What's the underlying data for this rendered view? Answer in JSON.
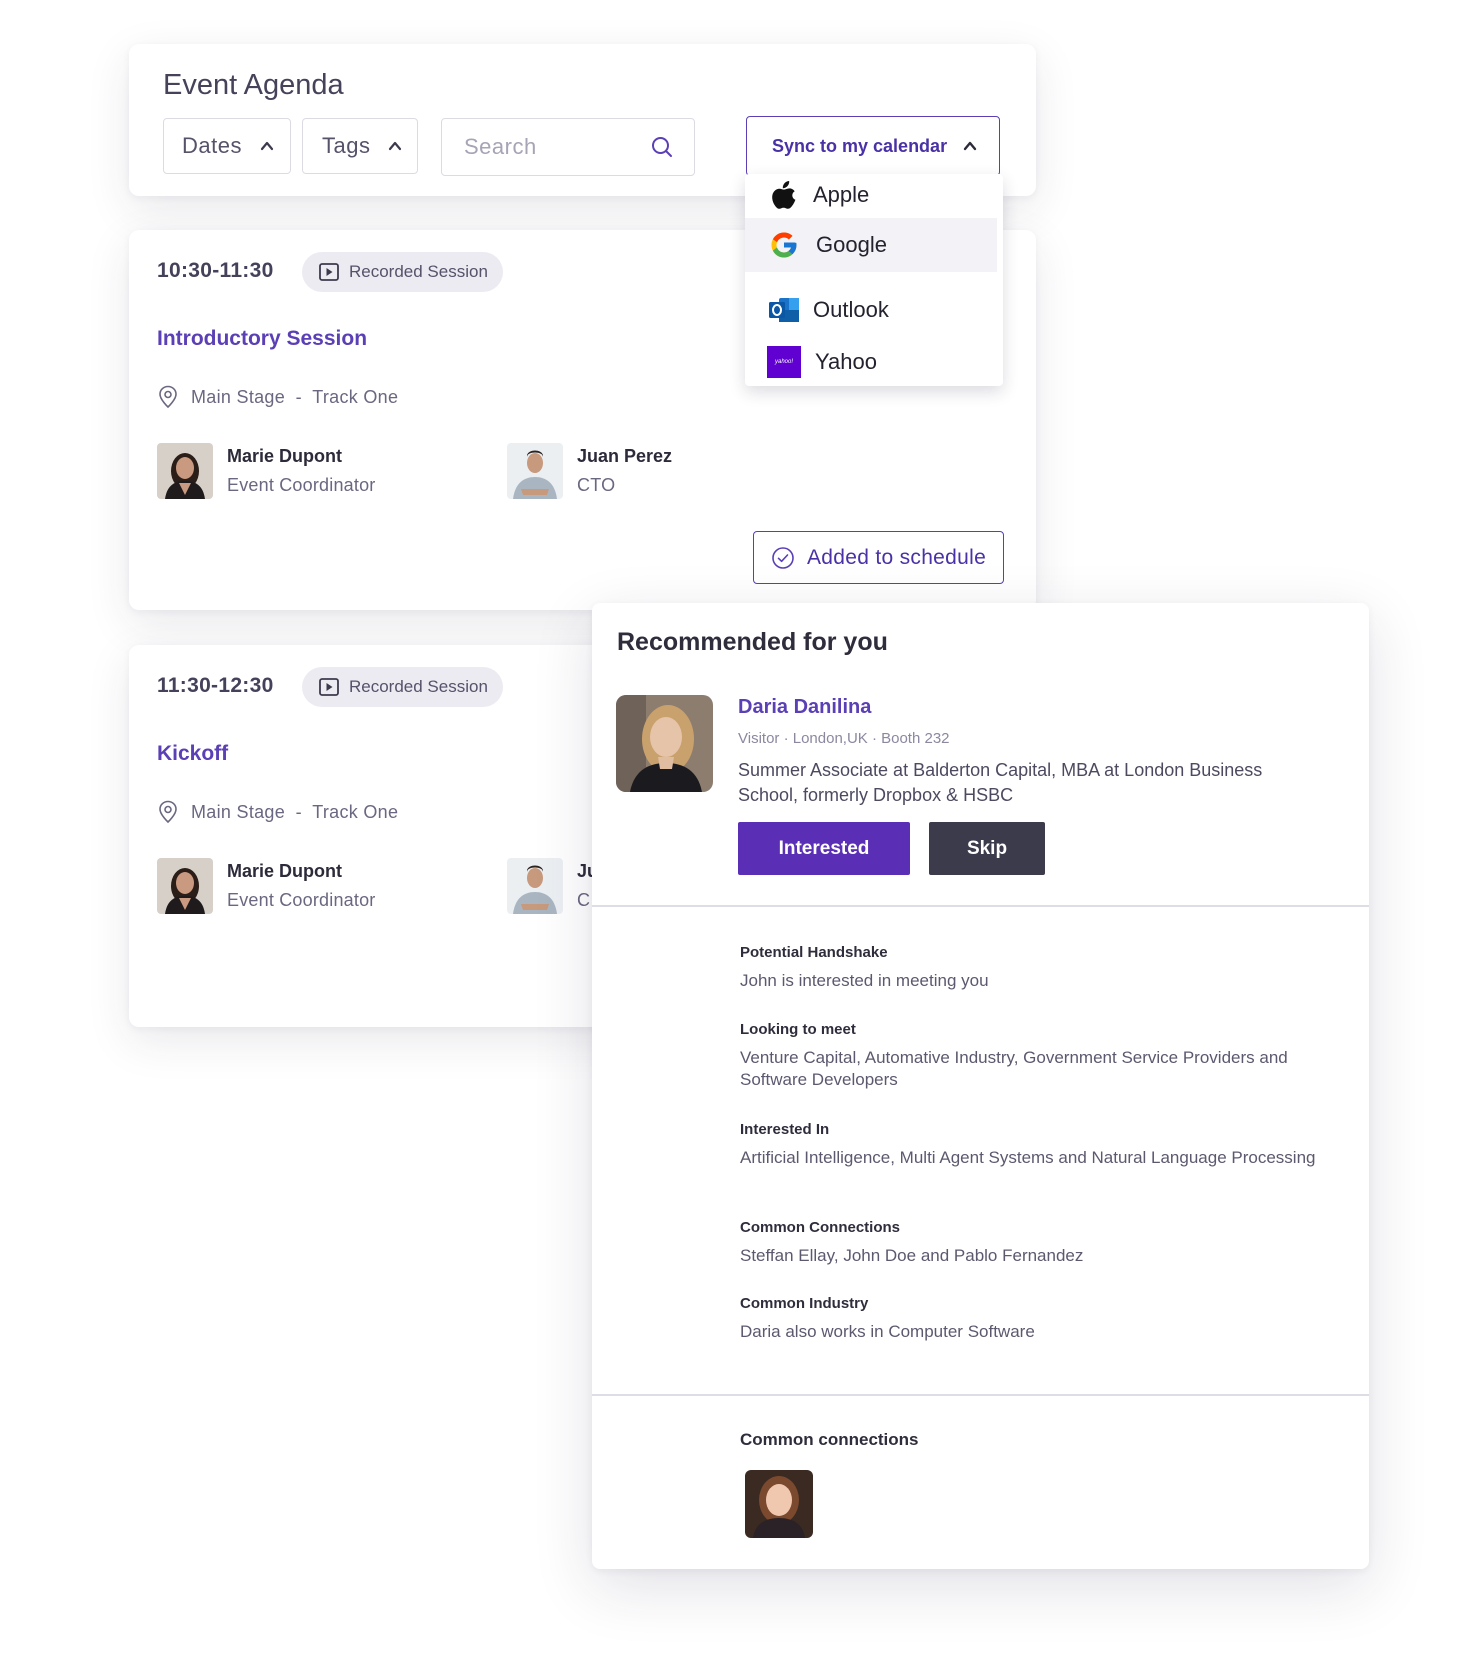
{
  "agenda": {
    "title": "Event Agenda",
    "filters": {
      "dates_label": "Dates",
      "tags_label": "Tags"
    },
    "search": {
      "placeholder": "Search"
    },
    "sync": {
      "label": "Sync to my calendar",
      "options": [
        {
          "label": "Apple",
          "icon": "apple-icon"
        },
        {
          "label": "Google",
          "icon": "google-icon"
        },
        {
          "label": "Outlook",
          "icon": "outlook-icon"
        },
        {
          "label": "Yahoo",
          "icon": "yahoo-icon",
          "icon_text": "yahoo!"
        }
      ]
    }
  },
  "sessions": [
    {
      "time": "10:30-11:30",
      "badge": "Recorded Session",
      "title": "Introductory Session",
      "location": "Main Stage  -  Track One",
      "speakers": [
        {
          "name": "Marie Dupont",
          "role": "Event Coordinator"
        },
        {
          "name": "Juan Perez",
          "role": "CTO"
        }
      ],
      "action_label": "Added to schedule"
    },
    {
      "time": "11:30-12:30",
      "badge": "Recorded Session",
      "title": "Kickoff",
      "location": "Main Stage  -  Track One",
      "speakers": [
        {
          "name": "Marie Dupont",
          "role": "Event Coordinator"
        },
        {
          "name": "Ju",
          "role": "C"
        }
      ]
    }
  ],
  "recommendation": {
    "heading": "Recommended for you",
    "person": {
      "name": "Daria Danilina",
      "meta": "Visitor · London,UK · Booth 232",
      "bio": "Summer Associate at Balderton Capital, MBA at London Business School, formerly Dropbox & HSBC"
    },
    "interested_label": "Interested",
    "skip_label": "Skip",
    "details": [
      {
        "label": "Potential Handshake",
        "value": "John is interested in meeting you"
      },
      {
        "label": "Looking to meet",
        "value": "Venture Capital, Automative Industry, Government Service Providers and Software Developers"
      },
      {
        "label": "Interested In",
        "value": "Artificial Intelligence, Multi Agent Systems and Natural Language Processing"
      },
      {
        "label": "Common Connections",
        "value": "Steffan Ellay, John Doe and Pablo Fernandez"
      },
      {
        "label": "Common Industry",
        "value": "Daria also works in Computer Software"
      }
    ],
    "common_connections_label": "Common connections"
  },
  "colors": {
    "accent": "#5b3fb5",
    "button_primary": "#5b2fb5",
    "button_secondary": "#3c3b4b",
    "badge_bg": "#ecebf1"
  }
}
